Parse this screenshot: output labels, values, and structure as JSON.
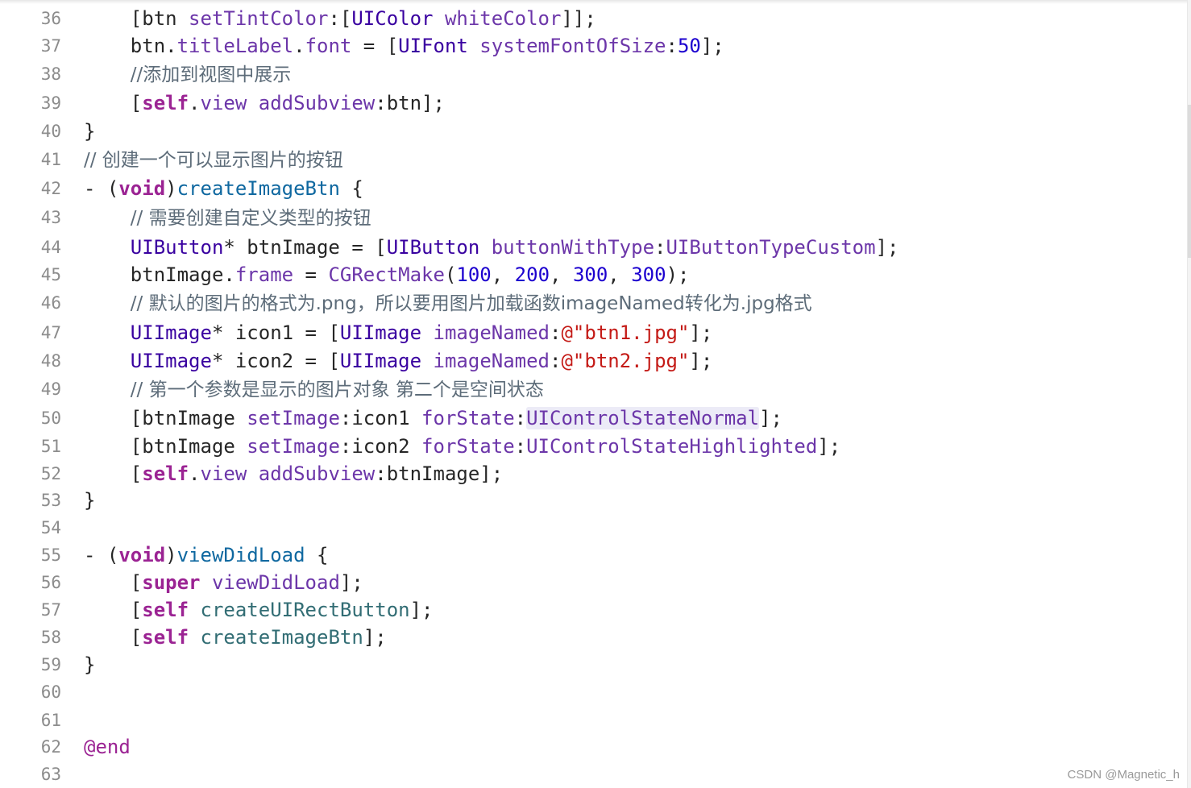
{
  "editor": {
    "watermark": "CSDN @Magnetic_h",
    "lines": [
      {
        "num": "36",
        "tokens": [
          [
            "plain",
            "    [btn "
          ],
          [
            "mth",
            "setTintColor"
          ],
          [
            "plain",
            ":["
          ],
          [
            "cls",
            "UIColor"
          ],
          [
            "plain",
            " "
          ],
          [
            "mth",
            "whiteColor"
          ],
          [
            "plain",
            "]];"
          ]
        ]
      },
      {
        "num": "37",
        "tokens": [
          [
            "plain",
            "    btn."
          ],
          [
            "mth",
            "titleLabel"
          ],
          [
            "plain",
            "."
          ],
          [
            "mth",
            "font"
          ],
          [
            "plain",
            " = ["
          ],
          [
            "cls",
            "UIFont"
          ],
          [
            "plain",
            " "
          ],
          [
            "mth",
            "systemFontOfSize"
          ],
          [
            "plain",
            ":"
          ],
          [
            "num",
            "50"
          ],
          [
            "plain",
            "];"
          ]
        ]
      },
      {
        "num": "38",
        "tokens": [
          [
            "plain",
            "    "
          ],
          [
            "cmt",
            "//添加到视图中展示"
          ]
        ]
      },
      {
        "num": "39",
        "tokens": [
          [
            "plain",
            "    ["
          ],
          [
            "kw",
            "self"
          ],
          [
            "plain",
            "."
          ],
          [
            "mth",
            "view"
          ],
          [
            "plain",
            " "
          ],
          [
            "mth",
            "addSubview"
          ],
          [
            "plain",
            ":btn];"
          ]
        ]
      },
      {
        "num": "40",
        "tokens": [
          [
            "plain",
            "}"
          ]
        ]
      },
      {
        "num": "41",
        "tokens": [
          [
            "cmt",
            "// 创建一个可以显示图片的按钮"
          ]
        ]
      },
      {
        "num": "42",
        "tokens": [
          [
            "plain",
            "- ("
          ],
          [
            "kw",
            "void"
          ],
          [
            "plain",
            ")"
          ],
          [
            "def",
            "createImageBtn"
          ],
          [
            "plain",
            " {"
          ]
        ]
      },
      {
        "num": "43",
        "tokens": [
          [
            "plain",
            "    "
          ],
          [
            "cmt",
            "// 需要创建自定义类型的按钮"
          ]
        ]
      },
      {
        "num": "44",
        "tokens": [
          [
            "plain",
            "    "
          ],
          [
            "cls",
            "UIButton"
          ],
          [
            "plain",
            "* btnImage = ["
          ],
          [
            "cls",
            "UIButton"
          ],
          [
            "plain",
            " "
          ],
          [
            "mth",
            "buttonWithType"
          ],
          [
            "plain",
            ":"
          ],
          [
            "mth",
            "UIButtonTypeCustom"
          ],
          [
            "plain",
            "];"
          ]
        ]
      },
      {
        "num": "45",
        "tokens": [
          [
            "plain",
            "    btnImage."
          ],
          [
            "mth",
            "frame"
          ],
          [
            "plain",
            " = "
          ],
          [
            "mth",
            "CGRectMake"
          ],
          [
            "plain",
            "("
          ],
          [
            "num",
            "100"
          ],
          [
            "plain",
            ", "
          ],
          [
            "num",
            "200"
          ],
          [
            "plain",
            ", "
          ],
          [
            "num",
            "300"
          ],
          [
            "plain",
            ", "
          ],
          [
            "num",
            "300"
          ],
          [
            "plain",
            ");"
          ]
        ]
      },
      {
        "num": "46",
        "tokens": [
          [
            "plain",
            "    "
          ],
          [
            "cmt",
            "// 默认的图片的格式为.png，所以要用图片加载函数imageNamed转化为.jpg格式"
          ]
        ]
      },
      {
        "num": "47",
        "tokens": [
          [
            "plain",
            "    "
          ],
          [
            "cls",
            "UIImage"
          ],
          [
            "plain",
            "* icon1 = ["
          ],
          [
            "cls",
            "UIImage"
          ],
          [
            "plain",
            " "
          ],
          [
            "mth",
            "imageNamed"
          ],
          [
            "plain",
            ":"
          ],
          [
            "str",
            "@\"btn1.jpg\""
          ],
          [
            "plain",
            "];"
          ]
        ]
      },
      {
        "num": "48",
        "tokens": [
          [
            "plain",
            "    "
          ],
          [
            "cls",
            "UIImage"
          ],
          [
            "plain",
            "* icon2 = ["
          ],
          [
            "cls",
            "UIImage"
          ],
          [
            "plain",
            " "
          ],
          [
            "mth",
            "imageNamed"
          ],
          [
            "plain",
            ":"
          ],
          [
            "str",
            "@\"btn2.jpg\""
          ],
          [
            "plain",
            "];"
          ]
        ]
      },
      {
        "num": "49",
        "tokens": [
          [
            "plain",
            "    "
          ],
          [
            "cmt",
            "// 第一个参数是显示的图片对象 第二个是空间状态"
          ]
        ]
      },
      {
        "num": "50",
        "tokens": [
          [
            "plain",
            "    [btnImage "
          ],
          [
            "mth",
            "setImage"
          ],
          [
            "plain",
            ":icon1 "
          ],
          [
            "mth",
            "forState"
          ],
          [
            "plain",
            ":"
          ],
          [
            "mth hl",
            "UIControlStateNormal"
          ],
          [
            "plain",
            "];"
          ]
        ]
      },
      {
        "num": "51",
        "tokens": [
          [
            "plain",
            "    [btnImage "
          ],
          [
            "mth",
            "setImage"
          ],
          [
            "plain",
            ":icon2 "
          ],
          [
            "mth",
            "forState"
          ],
          [
            "plain",
            ":"
          ],
          [
            "mth",
            "UIControlStateHighlighted"
          ],
          [
            "plain",
            "];"
          ]
        ]
      },
      {
        "num": "52",
        "tokens": [
          [
            "plain",
            "    ["
          ],
          [
            "kw",
            "self"
          ],
          [
            "plain",
            "."
          ],
          [
            "mth",
            "view"
          ],
          [
            "plain",
            " "
          ],
          [
            "mth",
            "addSubview"
          ],
          [
            "plain",
            ":btnImage];"
          ]
        ]
      },
      {
        "num": "53",
        "tokens": [
          [
            "plain",
            "}"
          ]
        ]
      },
      {
        "num": "54",
        "tokens": []
      },
      {
        "num": "55",
        "tokens": [
          [
            "plain",
            "- ("
          ],
          [
            "kw",
            "void"
          ],
          [
            "plain",
            ")"
          ],
          [
            "def",
            "viewDidLoad"
          ],
          [
            "plain",
            " {"
          ]
        ]
      },
      {
        "num": "56",
        "tokens": [
          [
            "plain",
            "    ["
          ],
          [
            "kw",
            "super"
          ],
          [
            "plain",
            " "
          ],
          [
            "mth",
            "viewDidLoad"
          ],
          [
            "plain",
            "];"
          ]
        ]
      },
      {
        "num": "57",
        "tokens": [
          [
            "plain",
            "    ["
          ],
          [
            "kw",
            "self"
          ],
          [
            "plain",
            " "
          ],
          [
            "self-m",
            "createUIRectButton"
          ],
          [
            "plain",
            "];"
          ]
        ]
      },
      {
        "num": "58",
        "tokens": [
          [
            "plain",
            "    ["
          ],
          [
            "kw",
            "self"
          ],
          [
            "plain",
            " "
          ],
          [
            "self-m",
            "createImageBtn"
          ],
          [
            "plain",
            "];"
          ]
        ]
      },
      {
        "num": "59",
        "tokens": [
          [
            "plain",
            "}"
          ]
        ]
      },
      {
        "num": "60",
        "tokens": []
      },
      {
        "num": "61",
        "tokens": []
      },
      {
        "num": "62",
        "tokens": [
          [
            "at",
            "@end"
          ]
        ]
      },
      {
        "num": "63",
        "tokens": []
      }
    ]
  }
}
